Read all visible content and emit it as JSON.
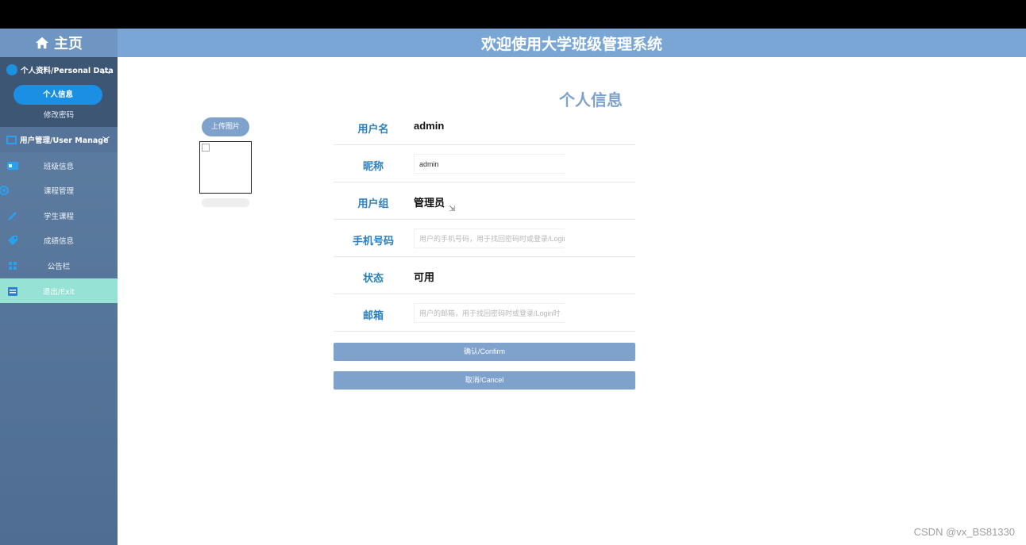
{
  "header": {
    "title": "欢迎使用大学班级管理系统"
  },
  "sidebar": {
    "home_label": "主页",
    "group_personal": {
      "label": "个人资料/Personal Data",
      "items": [
        "个人信息",
        "修改密码"
      ]
    },
    "group_user": {
      "label": "用户管理/User Manage"
    },
    "nav": [
      {
        "label": "班级信息",
        "icon": "card-icon"
      },
      {
        "label": "课程管理",
        "icon": "gear-icon"
      },
      {
        "label": "学生课程",
        "icon": "pen-icon"
      },
      {
        "label": "成绩信息",
        "icon": "tag-icon"
      },
      {
        "label": "公告栏",
        "icon": "cube-icon"
      },
      {
        "label": "退出/Exit",
        "icon": "clipboard-icon"
      }
    ]
  },
  "main": {
    "title": "个人信息",
    "upload_label": "上传图片",
    "fields": {
      "username": {
        "label": "用户名",
        "value": "admin"
      },
      "nickname": {
        "label": "昵称",
        "value": "admin"
      },
      "group": {
        "label": "用户组",
        "value": "管理员"
      },
      "phone": {
        "label": "手机号码",
        "placeholder": "用户的手机号码，用于找回密码时或登录/Login"
      },
      "status": {
        "label": "状态",
        "value": "可用"
      },
      "email": {
        "label": "邮箱",
        "placeholder": "用户的邮箱，用于找回密码时或登录/Login时"
      }
    },
    "confirm_label": "确认/Confirm",
    "cancel_label": "取消/Cancel"
  },
  "watermark": "CSDN @vx_BS81330",
  "colors": {
    "accent": "#7ea2cc",
    "header": "#7aa6d6",
    "active_pill": "#1a8fe3",
    "exit_bg": "#96e2d4",
    "label_blue": "#2b7fbd"
  }
}
